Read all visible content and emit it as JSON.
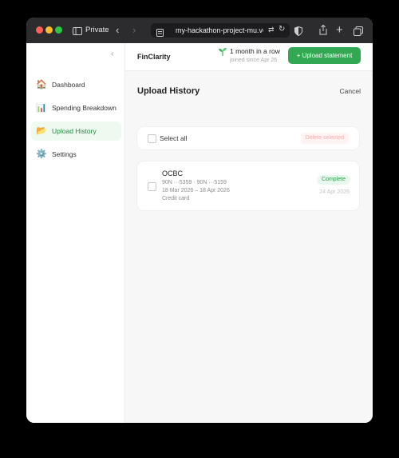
{
  "browser": {
    "mode_label": "Private",
    "url": "my-hackathon-project-mu.vercel.app"
  },
  "sidebar": {
    "items": [
      {
        "label": "Dashboard",
        "icon": "🏠"
      },
      {
        "label": "Spending Breakdown",
        "icon": "📊"
      },
      {
        "label": "Upload History",
        "icon": "📂"
      },
      {
        "label": "Settings",
        "icon": "⚙️"
      }
    ],
    "active_item": "Upload History"
  },
  "header": {
    "brand": "FinClarity",
    "streak_text": "1 month in a row",
    "streak_sub": "joined since Apr 26",
    "upload_button": "+ Upload statement"
  },
  "page": {
    "title": "Upload History",
    "cancel_label": "Cancel",
    "select_all_label": "Select all",
    "delete_selected_label": "Delete selected"
  },
  "uploads": [
    {
      "bank": "OCBC",
      "accounts": "90N ···5359 · 90N ···5159",
      "period": "18 Mar 2026 – 18 Apr 2026",
      "type": "Credit card",
      "status": "Complete",
      "uploaded": "24 Apr 2026"
    }
  ],
  "colors": {
    "accent": "#33a853",
    "active_nav_bg": "#eefaf0",
    "danger_text": "#f3b1b1"
  }
}
